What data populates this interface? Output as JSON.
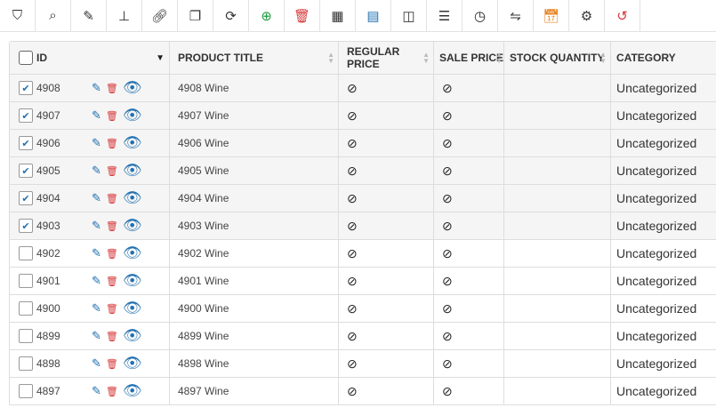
{
  "toolbar": [
    {
      "name": "filter-icon",
      "glyph": "⛉",
      "color": "#333"
    },
    {
      "name": "search-icon",
      "glyph": "⌕",
      "color": "#333"
    },
    {
      "name": "edit-icon",
      "glyph": "✎",
      "color": "#333"
    },
    {
      "name": "sitemap-icon",
      "glyph": "⊥",
      "color": "#333"
    },
    {
      "name": "link-icon",
      "glyph": "🔗︎",
      "color": "#333"
    },
    {
      "name": "copy-icon",
      "glyph": "❐",
      "color": "#333"
    },
    {
      "name": "refresh-icon",
      "glyph": "⟳",
      "color": "#333"
    },
    {
      "name": "add-icon",
      "glyph": "⊕",
      "color": "#1a9a3c"
    },
    {
      "name": "trash-icon",
      "glyph": "🗑︎",
      "color": "#d63638"
    },
    {
      "name": "table-icon",
      "glyph": "▦",
      "color": "#333"
    },
    {
      "name": "spreadsheet-icon",
      "glyph": "▤",
      "color": "#2271b1"
    },
    {
      "name": "columns-icon",
      "glyph": "◫",
      "color": "#333"
    },
    {
      "name": "list-icon",
      "glyph": "☰",
      "color": "#333"
    },
    {
      "name": "history-icon",
      "glyph": "◷",
      "color": "#222"
    },
    {
      "name": "swap-icon",
      "glyph": "⇋",
      "color": "#333"
    },
    {
      "name": "schedule-icon",
      "glyph": "📅︎",
      "color": "#e8892a"
    },
    {
      "name": "settings-icon",
      "glyph": "⚙",
      "color": "#333"
    },
    {
      "name": "reset-icon",
      "glyph": "↺",
      "color": "#d63638"
    }
  ],
  "headers": {
    "id": "ID",
    "title": "PRODUCT TITLE",
    "regular": "REGULAR PRICE",
    "sale": "SALE PRICE",
    "stock": "STOCK QUANTITY",
    "category": "CATEGORY"
  },
  "rows": [
    {
      "id": "4908",
      "title": "4908 Wine",
      "category": "Uncategorized",
      "checked": true
    },
    {
      "id": "4907",
      "title": "4907 Wine",
      "category": "Uncategorized",
      "checked": true
    },
    {
      "id": "4906",
      "title": "4906 Wine",
      "category": "Uncategorized",
      "checked": true
    },
    {
      "id": "4905",
      "title": "4905 Wine",
      "category": "Uncategorized",
      "checked": true
    },
    {
      "id": "4904",
      "title": "4904 Wine",
      "category": "Uncategorized",
      "checked": true
    },
    {
      "id": "4903",
      "title": "4903 Wine",
      "category": "Uncategorized",
      "checked": true
    },
    {
      "id": "4902",
      "title": "4902 Wine",
      "category": "Uncategorized",
      "checked": false
    },
    {
      "id": "4901",
      "title": "4901 Wine",
      "category": "Uncategorized",
      "checked": false
    },
    {
      "id": "4900",
      "title": "4900 Wine",
      "category": "Uncategorized",
      "checked": false
    },
    {
      "id": "4899",
      "title": "4899 Wine",
      "category": "Uncategorized",
      "checked": false
    },
    {
      "id": "4898",
      "title": "4898 Wine",
      "category": "Uncategorized",
      "checked": false
    },
    {
      "id": "4897",
      "title": "4897 Wine",
      "category": "Uncategorized",
      "checked": false
    }
  ]
}
